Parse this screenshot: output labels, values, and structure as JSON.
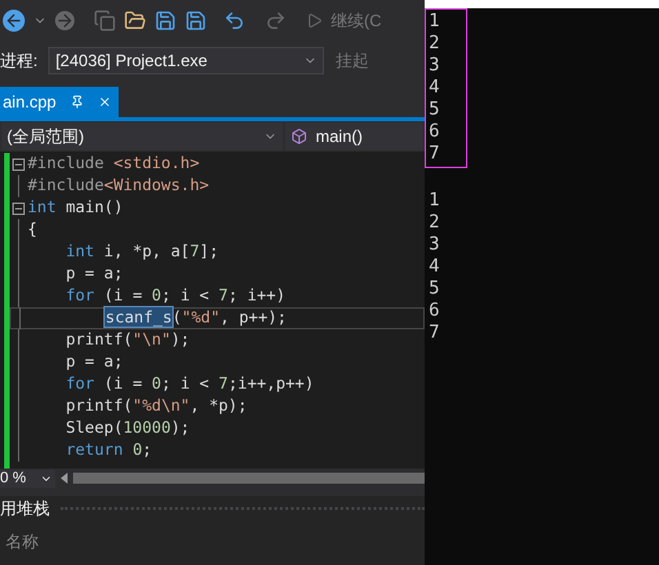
{
  "toolbar": {
    "continue_label": "继续(C"
  },
  "process": {
    "label": "进程:",
    "value": "[24036] Project1.exe",
    "suspend_label": "挂起"
  },
  "tab": {
    "label": "ain.cpp",
    "selected": true
  },
  "nav": {
    "scope": "(全局范围)",
    "function": "main()"
  },
  "code": [
    {
      "fold": true,
      "tokens": [
        {
          "kind": "pre",
          "text": "#include "
        },
        {
          "kind": "str",
          "text": "<stdio.h>"
        }
      ]
    },
    {
      "fold": false,
      "tokens": [
        {
          "kind": "pre",
          "text": "#include"
        },
        {
          "kind": "str",
          "text": "<Windows.h>"
        }
      ]
    },
    {
      "fold": true,
      "tokens": [
        {
          "kind": "kw",
          "text": "int"
        },
        {
          "kind": "plain",
          "text": " main()"
        }
      ]
    },
    {
      "fold": false,
      "tokens": [
        {
          "kind": "plain",
          "text": "{"
        }
      ]
    },
    {
      "fold": false,
      "tokens": [
        {
          "kind": "kw",
          "text": "    int"
        },
        {
          "kind": "plain",
          "text": " i, *p, a["
        },
        {
          "kind": "num",
          "text": "7"
        },
        {
          "kind": "plain",
          "text": "];"
        }
      ]
    },
    {
      "fold": false,
      "tokens": [
        {
          "kind": "plain",
          "text": "    p = a;"
        }
      ]
    },
    {
      "fold": false,
      "tokens": [
        {
          "kind": "kw",
          "text": "    for"
        },
        {
          "kind": "plain",
          "text": " (i = "
        },
        {
          "kind": "num",
          "text": "0"
        },
        {
          "kind": "plain",
          "text": "; i < "
        },
        {
          "kind": "num",
          "text": "7"
        },
        {
          "kind": "plain",
          "text": "; i++)"
        }
      ]
    },
    {
      "fold": false,
      "current": true,
      "tokens": [
        {
          "kind": "sel",
          "text": "        scanf_s"
        },
        {
          "kind": "plain",
          "text": "("
        },
        {
          "kind": "str",
          "text": "\"%d\""
        },
        {
          "kind": "plain",
          "text": ", p++);"
        }
      ]
    },
    {
      "fold": false,
      "tokens": [
        {
          "kind": "plain",
          "text": "    printf("
        },
        {
          "kind": "str",
          "text": "\"\\n\""
        },
        {
          "kind": "plain",
          "text": ");"
        }
      ]
    },
    {
      "fold": false,
      "tokens": [
        {
          "kind": "plain",
          "text": "    p = a;"
        }
      ]
    },
    {
      "fold": false,
      "tokens": [
        {
          "kind": "kw",
          "text": "    for"
        },
        {
          "kind": "plain",
          "text": " (i = "
        },
        {
          "kind": "num",
          "text": "0"
        },
        {
          "kind": "plain",
          "text": "; i < "
        },
        {
          "kind": "num",
          "text": "7"
        },
        {
          "kind": "plain",
          "text": ";i++,p++)"
        }
      ]
    },
    {
      "fold": false,
      "tokens": [
        {
          "kind": "plain",
          "text": "    printf("
        },
        {
          "kind": "str",
          "text": "\"%d\\n\""
        },
        {
          "kind": "plain",
          "text": ", *p);"
        }
      ]
    },
    {
      "fold": false,
      "tokens": [
        {
          "kind": "plain",
          "text": "    Sleep("
        },
        {
          "kind": "num",
          "text": "10000"
        },
        {
          "kind": "plain",
          "text": ");"
        }
      ]
    },
    {
      "fold": false,
      "tokens": [
        {
          "kind": "kw",
          "text": "    return"
        },
        {
          "kind": "num",
          "text": " 0"
        },
        {
          "kind": "plain",
          "text": ";"
        }
      ]
    }
  ],
  "zoom": "0 %",
  "call_stack": {
    "title": "用堆栈",
    "column": "名称"
  },
  "console": {
    "input_lines": [
      "1",
      "2",
      "3",
      "4",
      "5",
      "6",
      "7"
    ],
    "output_lines": [
      "1",
      "2",
      "3",
      "4",
      "5",
      "6",
      "7"
    ]
  }
}
